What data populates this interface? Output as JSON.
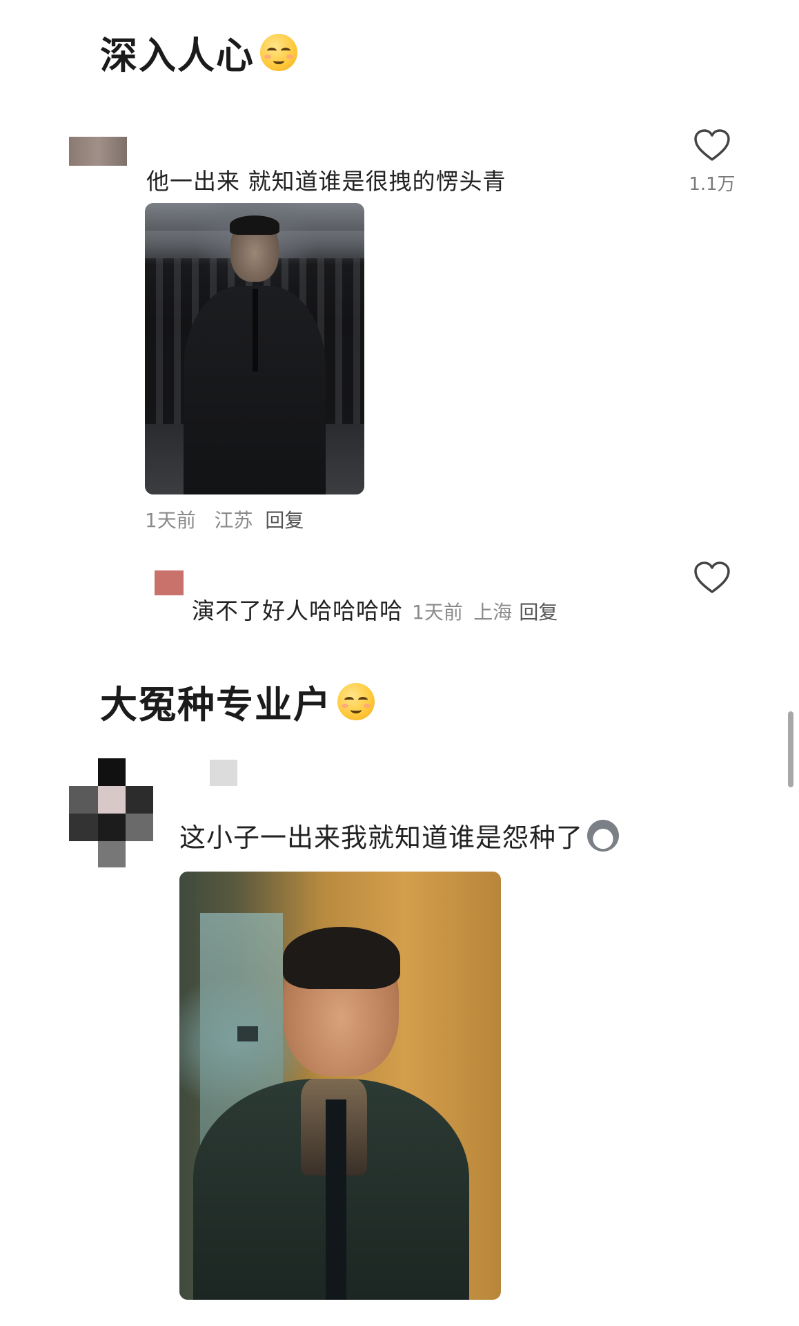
{
  "section1": {
    "heading": "深入人心",
    "comment": {
      "text": "他一出来  就知道谁是很拽的愣头青",
      "like_count": "1.1万",
      "meta_time": "1天前",
      "meta_location": "江苏",
      "reply_label": "回复"
    },
    "sub_reply": {
      "text": "演不了好人哈哈哈哈",
      "meta_time": "1天前",
      "meta_location": "上海",
      "reply_label": "回复"
    }
  },
  "section2": {
    "heading": "大冤种专业户",
    "comment": {
      "text": "这小子一出来我就知道谁是怨种了"
    }
  },
  "icons": {
    "like": "heart-outline-icon",
    "heading_emoji": "smug-face-emoji",
    "wolf_sticker": "wolf-emoji"
  },
  "colors": {
    "text_primary": "#1b1b1b",
    "text_meta": "#8a8a8a",
    "heart": "#444444"
  }
}
